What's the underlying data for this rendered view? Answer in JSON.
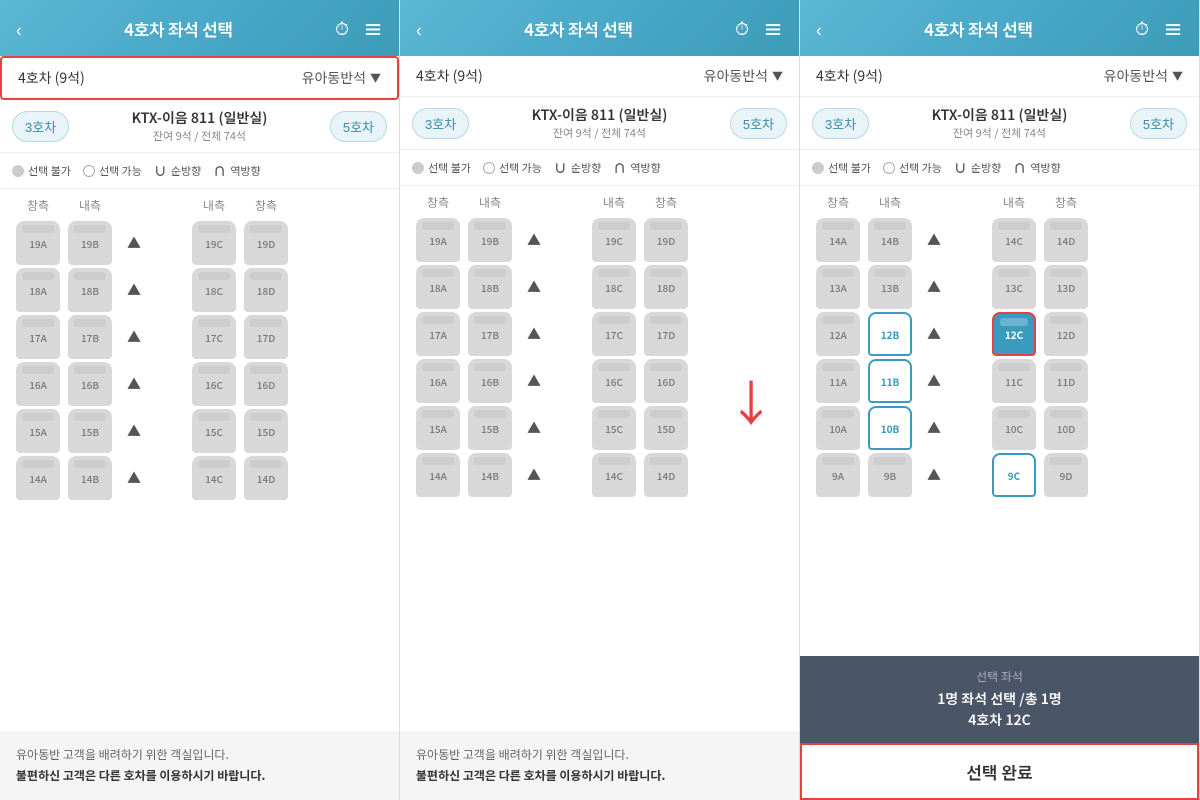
{
  "panels": [
    {
      "id": "panel1",
      "header": {
        "back_label": "‹",
        "title": "4호차 좌석 선택",
        "clock_icon": "⏱",
        "menu_icon": "≡"
      },
      "car_selector": {
        "label": "4호차 (9석)",
        "dropdown": "유아동반석",
        "dropdown_arrow": "▼",
        "highlighted": true
      },
      "train_info": {
        "prev_car": "3호차",
        "train_name": "KTX-이음 811 (일반실)",
        "train_sub": "잔여 9석 / 전체 74석",
        "next_car": "5호차"
      },
      "legend": [
        {
          "type": "unavail",
          "label": "선택 불가"
        },
        {
          "type": "avail",
          "label": "선택 가능"
        },
        {
          "type": "forward",
          "label": "순방향"
        },
        {
          "type": "backward",
          "label": "역방향"
        }
      ],
      "col_headers": [
        "창측",
        "내측",
        "",
        "",
        "내측",
        "창측"
      ],
      "rows": [
        {
          "seats": [
            "19A",
            "19B",
            "▲",
            "",
            "19C",
            "19D"
          ]
        },
        {
          "seats": [
            "18A",
            "18B",
            "▲",
            "",
            "18C",
            "18D"
          ]
        },
        {
          "seats": [
            "17A",
            "17B",
            "▲",
            "",
            "17C",
            "17D"
          ]
        },
        {
          "seats": [
            "16A",
            "16B",
            "▲",
            "",
            "16C",
            "16D"
          ]
        },
        {
          "seats": [
            "15A",
            "15B",
            "▲",
            "",
            "15C",
            "15D"
          ]
        },
        {
          "seats": [
            "14A",
            "14B",
            "▲",
            "",
            "14C",
            "14D"
          ]
        }
      ],
      "footer": {
        "line1": "유아동반 고객을 배려하기 위한 객실입니다.",
        "line2": "불편하신 고객은 다른 호차를 이용하시기 바랍니다."
      }
    },
    {
      "id": "panel2",
      "header": {
        "back_label": "‹",
        "title": "4호차 좌석 선택",
        "clock_icon": "⏱",
        "menu_icon": "≡"
      },
      "car_selector": {
        "label": "4호차 (9석)",
        "dropdown": "유아동반석",
        "dropdown_arrow": "▼",
        "highlighted": false
      },
      "train_info": {
        "prev_car": "3호차",
        "train_name": "KTX-이음 811 (일반실)",
        "train_sub": "잔여 9석 / 전체 74석",
        "next_car": "5호차"
      },
      "legend": [
        {
          "type": "unavail",
          "label": "선택 불가"
        },
        {
          "type": "avail",
          "label": "선택 가능"
        },
        {
          "type": "forward",
          "label": "순방향"
        },
        {
          "type": "backward",
          "label": "역방향"
        }
      ],
      "col_headers": [
        "창측",
        "내측",
        "",
        "",
        "내측",
        "창측"
      ],
      "rows": [
        {
          "seats": [
            "19A",
            "19B",
            "▲",
            "",
            "19C",
            "19D"
          ]
        },
        {
          "seats": [
            "18A",
            "18B",
            "▲",
            "",
            "18C",
            "18D"
          ]
        },
        {
          "seats": [
            "17A",
            "17B",
            "▲",
            "",
            "17C",
            "17D"
          ]
        },
        {
          "seats": [
            "16A",
            "16B",
            "▲",
            "",
            "16C",
            "16D"
          ]
        },
        {
          "seats": [
            "15A",
            "15B",
            "▲",
            "",
            "15C",
            "15D"
          ]
        },
        {
          "seats": [
            "14A",
            "14B",
            "▲",
            "",
            "14C",
            "14D"
          ]
        }
      ],
      "scroll_arrow": "↓",
      "footer": {
        "line1": "유아동반 고객을 배려하기 위한 객실입니다.",
        "line2": "불편하신 고객은 다른 호차를 이용하시기 바랍니다."
      }
    },
    {
      "id": "panel3",
      "header": {
        "back_label": "‹",
        "title": "4호차 좌석 선택",
        "clock_icon": "⏱",
        "menu_icon": "≡"
      },
      "car_selector": {
        "label": "4호차 (9석)",
        "dropdown": "유아동반석",
        "dropdown_arrow": "▼",
        "highlighted": false
      },
      "train_info": {
        "prev_car": "3호차",
        "train_name": "KTX-이음 811 (일반실)",
        "train_sub": "잔여 9석 / 전체 74석",
        "next_car": "5호차"
      },
      "legend": [
        {
          "type": "unavail",
          "label": "선택 불가"
        },
        {
          "type": "avail",
          "label": "선택 가능"
        },
        {
          "type": "forward",
          "label": "순방향"
        },
        {
          "type": "backward",
          "label": "역방향"
        }
      ],
      "col_headers": [
        "창측",
        "내측",
        "",
        "",
        "내측",
        "창측"
      ],
      "rows": [
        {
          "seats": [
            "14A",
            "14B",
            "▲",
            "",
            "14C",
            "14D"
          ],
          "types": [
            "u",
            "u",
            "arrow",
            "",
            "u",
            "u"
          ]
        },
        {
          "seats": [
            "13A",
            "13B",
            "▲",
            "",
            "13C",
            "13D"
          ],
          "types": [
            "u",
            "u",
            "arrow",
            "",
            "u",
            "u"
          ]
        },
        {
          "seats": [
            "12A",
            "12B",
            "▲",
            "",
            "12C",
            "12D"
          ],
          "types": [
            "u",
            "avail",
            "arrow",
            "",
            "selected",
            "u"
          ],
          "selected_12b": true,
          "selected_12c": true
        },
        {
          "seats": [
            "11A",
            "11B",
            "▲",
            "",
            "11C",
            "11D"
          ],
          "types": [
            "u",
            "avail",
            "arrow",
            "",
            "u",
            "u"
          ]
        },
        {
          "seats": [
            "10A",
            "10B",
            "▲",
            "",
            "10C",
            "10D"
          ],
          "types": [
            "u",
            "avail",
            "arrow",
            "",
            "u",
            "u"
          ]
        },
        {
          "seats": [
            "9A",
            "9B",
            "▲",
            "",
            "9C",
            "9D"
          ],
          "types": [
            "u",
            "u",
            "arrow",
            "",
            "avail",
            "u"
          ]
        }
      ],
      "selected_bar": {
        "title": "선택 좌석",
        "detail_line1": "1명 좌석 선택 /총 1명",
        "detail_line2": "4호차 12C"
      },
      "confirm_btn": "선택 완료"
    }
  ]
}
